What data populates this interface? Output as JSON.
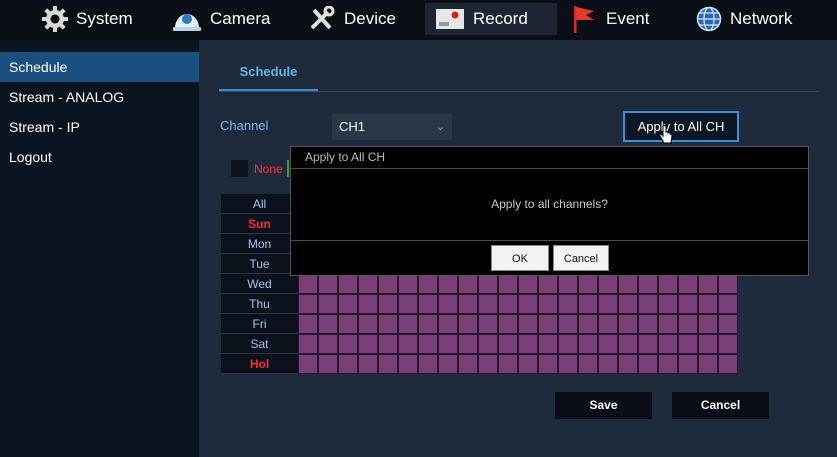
{
  "nav": [
    {
      "label": "System",
      "icon": "gear-icon"
    },
    {
      "label": "Camera",
      "icon": "camera-icon"
    },
    {
      "label": "Device",
      "icon": "tools-icon"
    },
    {
      "label": "Record",
      "icon": "record-icon"
    },
    {
      "label": "Event",
      "icon": "flag-icon"
    },
    {
      "label": "Network",
      "icon": "globe-icon"
    }
  ],
  "sidebar": {
    "items": [
      "Schedule",
      "Stream - ANALOG",
      "Stream - IP",
      "Logout"
    ]
  },
  "tab": {
    "label": "Schedule"
  },
  "channel": {
    "label": "Channel",
    "value": "CH1"
  },
  "apply_button": "Apply to All CH",
  "legend": {
    "label": "None"
  },
  "days": [
    "All",
    "Sun",
    "Mon",
    "Tue",
    "Wed",
    "Thu",
    "Fri",
    "Sat",
    "Hol"
  ],
  "footer": {
    "save": "Save",
    "cancel": "Cancel"
  },
  "dialog": {
    "title": "Apply to All CH",
    "message": "Apply to all channels?",
    "ok": "OK",
    "cancel": "Cancel"
  },
  "colors": {
    "accent": "#3d8ed8",
    "schedule_cell": "#7a3e78",
    "holiday": "#ff2a2a"
  }
}
